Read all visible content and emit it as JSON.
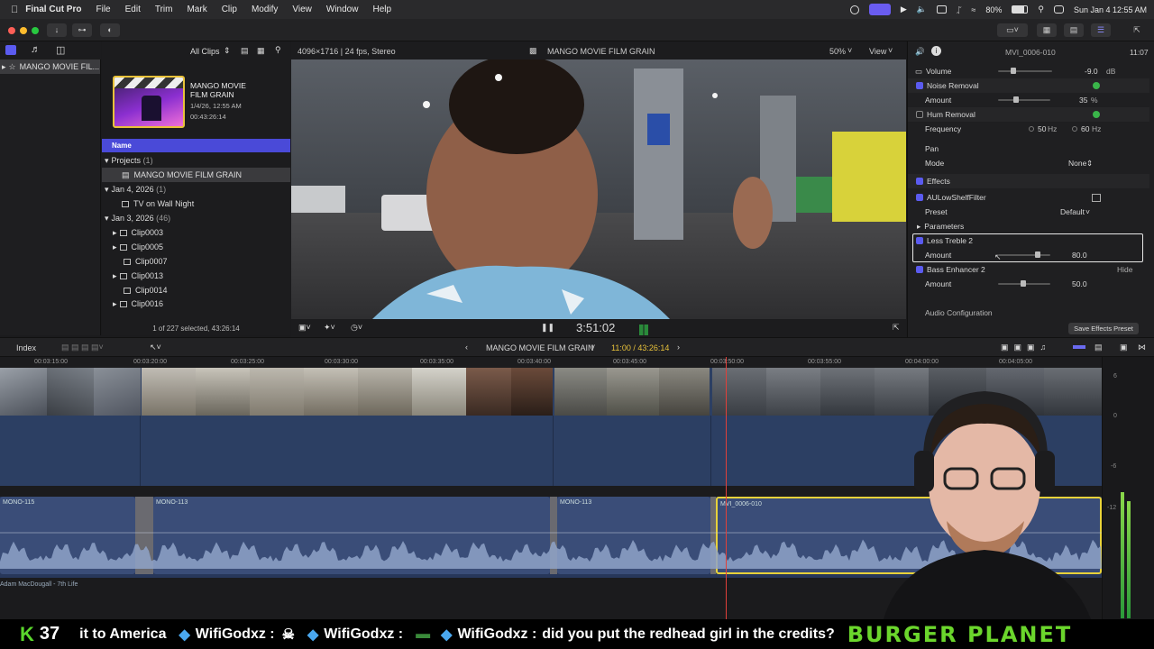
{
  "menubar": {
    "app_name": "Final Cut Pro",
    "items": [
      "File",
      "Edit",
      "Trim",
      "Mark",
      "Clip",
      "Modify",
      "View",
      "Window",
      "Help"
    ],
    "battery": "80%",
    "clock": "Sun Jan 4  12:55 AM"
  },
  "browser": {
    "library_item": "MANGO MOVIE FIL...",
    "filter_label": "All Clips",
    "project_card": {
      "title": "MANGO MOVIE FILM GRAIN",
      "date": "1/4/26, 12:55 AM",
      "duration": "00:43:26:14"
    },
    "column_header": "Name",
    "rows": [
      {
        "label": "Projects",
        "count": "(1)",
        "kind": "group"
      },
      {
        "label": "MANGO MOVIE FILM GRAIN",
        "count": "",
        "kind": "selected"
      },
      {
        "label": "Jan 4, 2026",
        "count": "(1)",
        "kind": "group"
      },
      {
        "label": "TV on Wall Night",
        "count": "",
        "kind": "clip"
      },
      {
        "label": "Jan 3, 2026",
        "count": "(46)",
        "kind": "group"
      },
      {
        "label": "Clip0003",
        "count": "",
        "kind": "clip"
      },
      {
        "label": "Clip0005",
        "count": "",
        "kind": "clip"
      },
      {
        "label": "Clip0007",
        "count": "",
        "kind": "clip"
      },
      {
        "label": "Clip0013",
        "count": "",
        "kind": "clip"
      },
      {
        "label": "Clip0014",
        "count": "",
        "kind": "clip"
      },
      {
        "label": "Clip0016",
        "count": "",
        "kind": "clip"
      }
    ],
    "selection_status": "1 of 227 selected, 43:26:14"
  },
  "viewer": {
    "format_info": "4096×1716 | 24 fps, Stereo",
    "project_title": "MANGO MOVIE FILM GRAIN",
    "zoom": "50%",
    "view_menu": "View",
    "timecode": "3:51:02"
  },
  "inspector": {
    "clip_name": "MVI_0006-010",
    "clip_duration": "11:07",
    "volume_label": "Volume",
    "volume_value": "-9.0",
    "volume_unit": "dB",
    "noise_removal": "Noise Removal",
    "amount_label": "Amount",
    "noise_amount": "35",
    "noise_unit": "%",
    "hum_removal": "Hum Removal",
    "frequency_label": "Frequency",
    "freq_50": "50",
    "freq_60": "60",
    "hz": "Hz",
    "pan_label": "Pan",
    "mode_label": "Mode",
    "mode_value": "None",
    "effects_label": "Effects",
    "effect1": "AULowShelfFilter",
    "preset_label": "Preset",
    "preset_value": "Default",
    "parameters_label": "Parameters",
    "effect2": "Less Treble 2",
    "effect2_amount": "80.0",
    "effect3": "Bass Enhancer 2",
    "hide_label": "Hide",
    "effect3_amount": "50.0",
    "audio_config": "Audio Configuration",
    "save_preset": "Save Effects Preset"
  },
  "timeline": {
    "index_label": "Index",
    "project_title": "MANGO MOVIE FILM GRAIN",
    "position": "11:00 / 43:26:14",
    "ruler_ticks": [
      "00:03:15:00",
      "00:03:20:00",
      "00:03:25:00",
      "00:03:30:00",
      "00:03:35:00",
      "00:03:40:00",
      "00:03:45:00",
      "00:03:50:00",
      "00:03:55:00",
      "00:04:00:00",
      "00:04:05:00"
    ],
    "audio_clips": [
      "MONO-115",
      "MONO-113",
      "MONO-113",
      "MVI_0006-010"
    ],
    "music_label": "Adam MacDougall - 7th Life",
    "meter_ticks": [
      "6",
      "0",
      "-6",
      "-12"
    ]
  },
  "ticker": {
    "count": "37",
    "text_a": "it to America",
    "user1": "WifiGodxz :",
    "user2": "WifiGodxz :",
    "user3": "WifiGodxz :",
    "message": "did you put the redhead girl in the credits?",
    "banner": "BURGER PLANET"
  },
  "colors": {
    "accent": "#5b5bf0",
    "audio_track": "#27375a",
    "video_track": "#2c3f63",
    "banner_green": "#6bd62c",
    "selection_yellow": "#e8d23a"
  }
}
